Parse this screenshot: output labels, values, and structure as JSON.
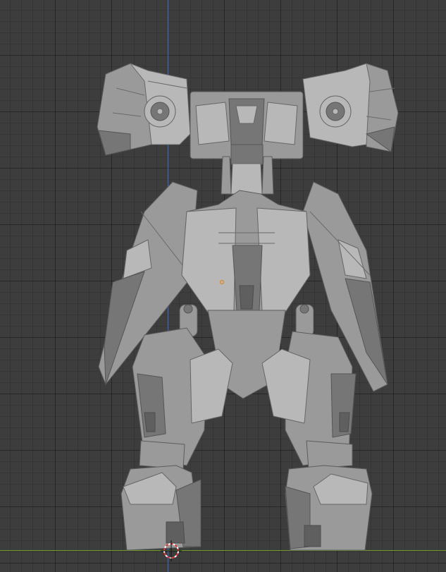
{
  "viewport": {
    "background": "#3d3d3d",
    "grid_color": "#333333",
    "z_axis_color": "#3e6dc8",
    "x_axis_color": "#6e9a2a",
    "origin_marker": "origin-dot",
    "cursor": "3d-cursor"
  },
  "model": {
    "color": "#9a9a9a"
  }
}
